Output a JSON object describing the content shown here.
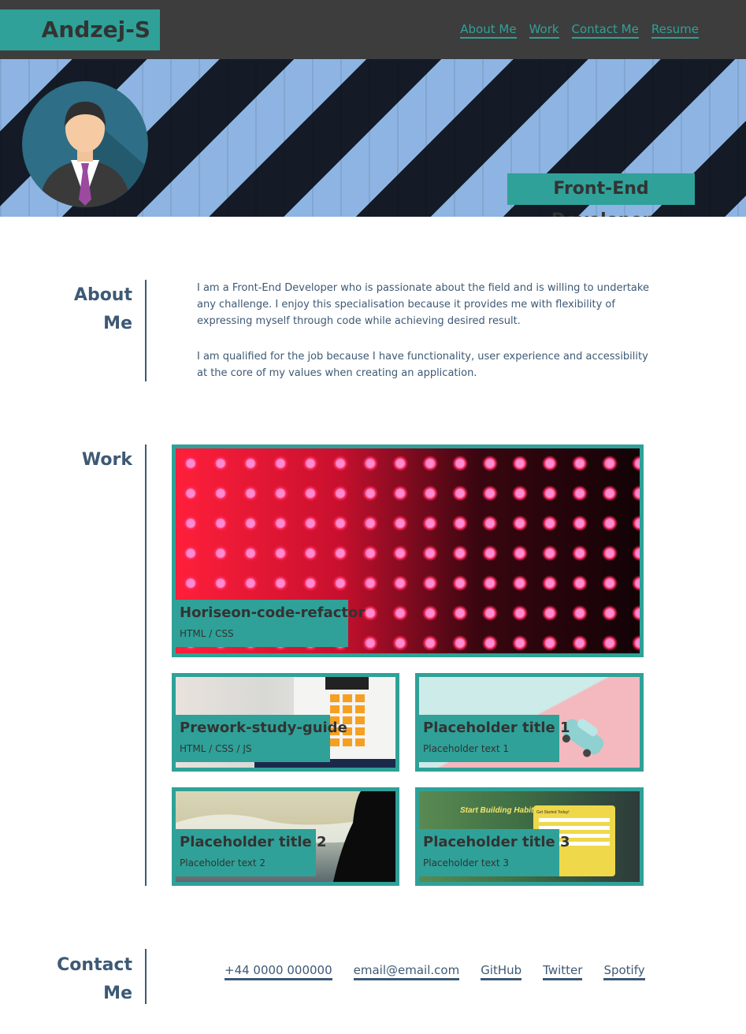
{
  "header": {
    "brand": "Andzej-S",
    "nav": [
      "About Me",
      "Work",
      "Contact Me",
      "Resume"
    ]
  },
  "hero": {
    "role": "Front-End Developer"
  },
  "about": {
    "title_line1": "About",
    "title_line2": "Me",
    "paragraphs": [
      "I am a Front-End Developer who is passionate about the field and is willing to undertake any challenge. I enjoy this specialisation because it provides me with flexibility of expressing myself through code while achieving desired result.",
      "I am qualified for the job because I have functionality, user experience and accessibility at the core of my values when creating an application."
    ]
  },
  "work": {
    "title": "Work",
    "projects": [
      {
        "title": "Horiseon-code-refactor",
        "subtitle": "HTML / CSS"
      },
      {
        "title": "Prework-study-guide",
        "subtitle": "HTML / CSS / JS"
      },
      {
        "title": "Placeholder title 1",
        "subtitle": "Placeholder text 1"
      },
      {
        "title": "Placeholder title 2",
        "subtitle": "Placeholder text 2"
      },
      {
        "title": "Placeholder title 3",
        "subtitle": "Placeholder text 3"
      }
    ],
    "habits_image_text": {
      "headline": "Start Building Habits.",
      "form_heading": "Get Started Today!"
    }
  },
  "contact": {
    "title_line1": "Contact",
    "title_line2": "Me",
    "links": [
      "+44 0000 000000",
      "email@email.com",
      "GitHub",
      "Twitter",
      "Spotify"
    ]
  },
  "colors": {
    "teal": "#2fa198",
    "header_bg": "#3d3d3d",
    "text_blue": "#3d5975"
  }
}
